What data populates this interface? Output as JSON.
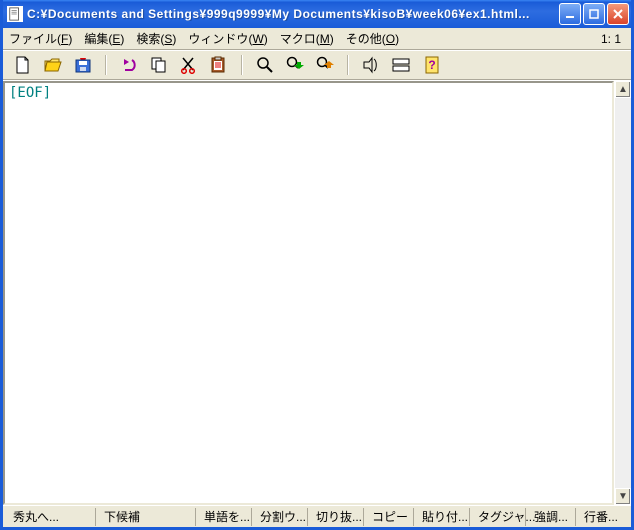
{
  "title": "C:¥Documents and Settings¥999q9999¥My Documents¥kisoB¥week06¥ex1.html...",
  "cursor_pos": "1: 1",
  "menu": {
    "file": {
      "label": "ファイル",
      "key": "F"
    },
    "edit": {
      "label": "編集",
      "key": "E"
    },
    "search": {
      "label": "検索",
      "key": "S"
    },
    "window": {
      "label": "ウィンドウ",
      "key": "W"
    },
    "macro": {
      "label": "マクロ",
      "key": "M"
    },
    "other": {
      "label": "その他",
      "key": "O"
    }
  },
  "editor": {
    "eof": "[EOF]"
  },
  "status": {
    "hidemaru": "秀丸へ...",
    "shitakouho": "下候補",
    "tango": "単語を...",
    "bunkatsu": "分割ウ...",
    "kirinuki": "切り抜...",
    "copy": "コピー",
    "paste": "貼り付...",
    "tagjump": "タグジャ...",
    "kyouchou": "強調...",
    "gyouban": "行番..."
  }
}
